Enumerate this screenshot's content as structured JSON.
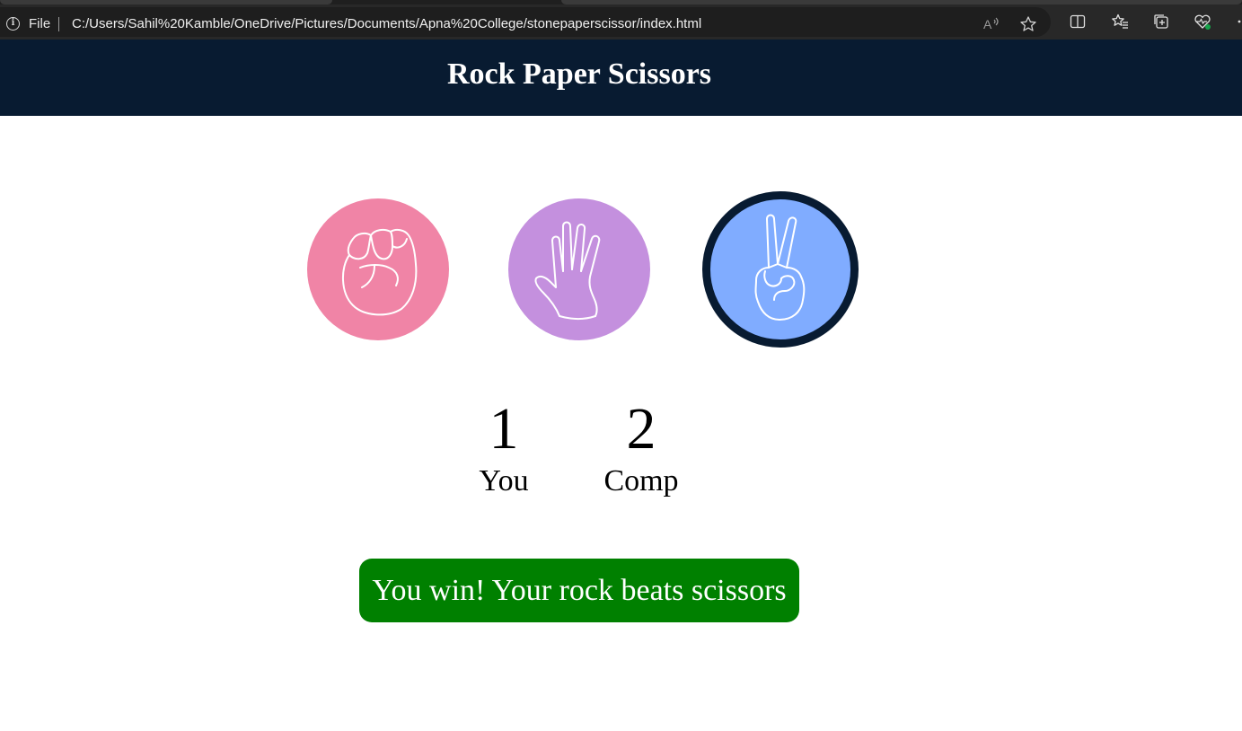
{
  "browser": {
    "file_label": "File",
    "url": "C:/Users/Sahil%20Kamble/OneDrive/Pictures/Documents/Apna%20College/stonepaperscissor/index.html",
    "icons": [
      "info-icon",
      "read-aloud-icon",
      "favorite-star-icon",
      "split-screen-icon",
      "favorites-icon",
      "collections-icon",
      "browser-essentials-icon",
      "more-icon"
    ]
  },
  "header": {
    "title": "Rock Paper Scissors",
    "background": "#081b31"
  },
  "choices": [
    {
      "id": "rock",
      "icon": "rock-hand-icon",
      "color": "#f084a6"
    },
    {
      "id": "paper",
      "icon": "paper-hand-icon",
      "color": "#c490de"
    },
    {
      "id": "scissors",
      "icon": "scissors-hand-icon",
      "color": "#80acff",
      "selected": true
    }
  ],
  "scoreboard": {
    "user": {
      "score": "1",
      "label": "You"
    },
    "comp": {
      "score": "2",
      "label": "Comp"
    }
  },
  "message": {
    "text": "You win! Your rock beats scissors",
    "background": "#008000"
  }
}
